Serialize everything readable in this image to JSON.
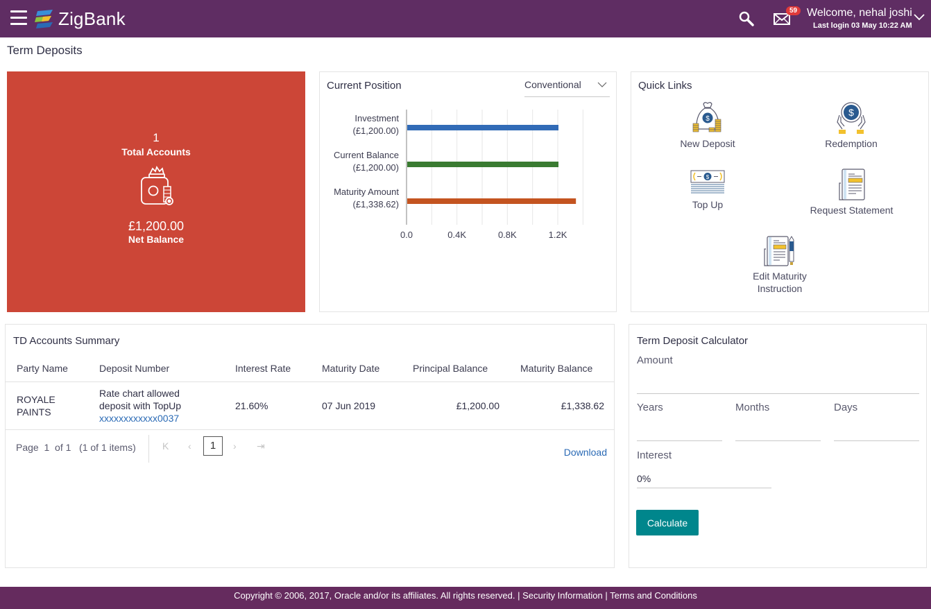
{
  "header": {
    "brand": "ZigBank",
    "notification_count": "59",
    "welcome": "Welcome, nehal joshi",
    "last_login": "Last login 03 May 10:22 AM",
    "colors": {
      "bar": "#5f2d63"
    }
  },
  "page": {
    "title": "Term Deposits"
  },
  "summary": {
    "count": "1",
    "count_label": "Total Accounts",
    "amount": "£1,200.00",
    "amount_label": "Net Balance",
    "icon": "piggy-jar-icon",
    "color": "#cc4637"
  },
  "current_position": {
    "title": "Current Position",
    "filter_value": "Conventional"
  },
  "chart_data": {
    "type": "bar",
    "orientation": "horizontal",
    "title": "Current Position",
    "categories": [
      {
        "name": "Investment",
        "label": "(£1,200.00)"
      },
      {
        "name": "Current Balance",
        "label": "(£1,200.00)"
      },
      {
        "name": "Maturity Amount",
        "label": "(£1,338.62)"
      }
    ],
    "values": [
      1200,
      1200,
      1338.62
    ],
    "colors": [
      "#316bb7",
      "#3a7b31",
      "#c45420"
    ],
    "xticks": [
      "0.0",
      "0.4K",
      "0.8K",
      "1.2K"
    ],
    "xtick_values": [
      0,
      400,
      800,
      1200
    ],
    "xlim": [
      0,
      1400
    ],
    "grid": true,
    "xlabel": "",
    "ylabel": ""
  },
  "quick_links": {
    "title": "Quick Links",
    "items": [
      {
        "label": "New Deposit",
        "icon": "money-bag-icon"
      },
      {
        "label": "Redemption",
        "icon": "coin-hands-icon"
      },
      {
        "label": "Top Up",
        "icon": "cash-stack-icon"
      },
      {
        "label": "Request Statement",
        "icon": "statement-icon"
      },
      {
        "label_line1": "Edit Maturity",
        "label_line2": "Instruction",
        "icon": "edit-document-icon"
      }
    ]
  },
  "td_summary": {
    "title": "TD Accounts Summary",
    "columns": [
      "Party Name",
      "Deposit Number",
      "Interest Rate",
      "Maturity Date",
      "Principal Balance",
      "Maturity Balance"
    ],
    "rows": [
      {
        "party_line1": "ROYALE",
        "party_line2": "PAINTS",
        "deposit_line1": "Rate chart allowed",
        "deposit_line2": "deposit with TopUp",
        "deposit_number": "xxxxxxxxxxxx0037",
        "interest_rate": "21.60%",
        "maturity_date": "07 Jun 2019",
        "principal_balance": "£1,200.00",
        "maturity_balance": "£1,338.62"
      }
    ],
    "pager": {
      "text": "Page  1  of 1   (1 of 1 items)",
      "current_page": "1"
    },
    "download_label": "Download"
  },
  "calculator": {
    "title": "Term Deposit Calculator",
    "amount_label": "Amount",
    "amount_value": "",
    "years_label": "Years",
    "months_label": "Months",
    "days_label": "Days",
    "interest_label": "Interest",
    "interest_value": "0%",
    "button_label": "Calculate",
    "button_color": "#00868c"
  },
  "footer": {
    "copyright": "Copyright © 2006, 2017, Oracle and/or its affiliates. All rights reserved. | ",
    "security": "Security Information",
    "separator": " | ",
    "terms": "Terms and Conditions"
  }
}
